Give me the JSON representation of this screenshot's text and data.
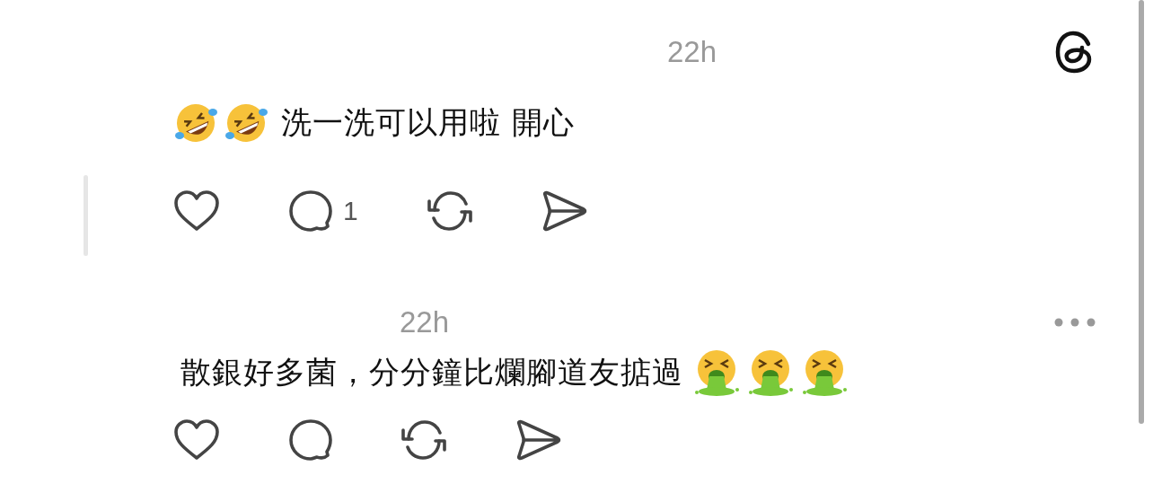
{
  "posts": [
    {
      "time": "22h",
      "corner": {
        "kind": "app-logo"
      },
      "thread_line": true,
      "emojis_before": [
        {
          "kind": "rolling-laughing"
        },
        {
          "kind": "rolling-laughing"
        }
      ],
      "text": "洗一洗可以用啦 開心",
      "actions": [
        {
          "kind": "like"
        },
        {
          "kind": "reply",
          "count": "1"
        },
        {
          "kind": "repost"
        },
        {
          "kind": "share"
        }
      ]
    },
    {
      "time": "22h",
      "corner": {
        "kind": "more"
      },
      "text": "散銀好多菌，分分鐘比爛腳道友掂過",
      "emojis_after": [
        {
          "kind": "vomiting"
        },
        {
          "kind": "vomiting"
        },
        {
          "kind": "vomiting"
        }
      ],
      "actions": [
        {
          "kind": "like"
        },
        {
          "kind": "reply"
        },
        {
          "kind": "repost"
        },
        {
          "kind": "share"
        }
      ]
    }
  ]
}
